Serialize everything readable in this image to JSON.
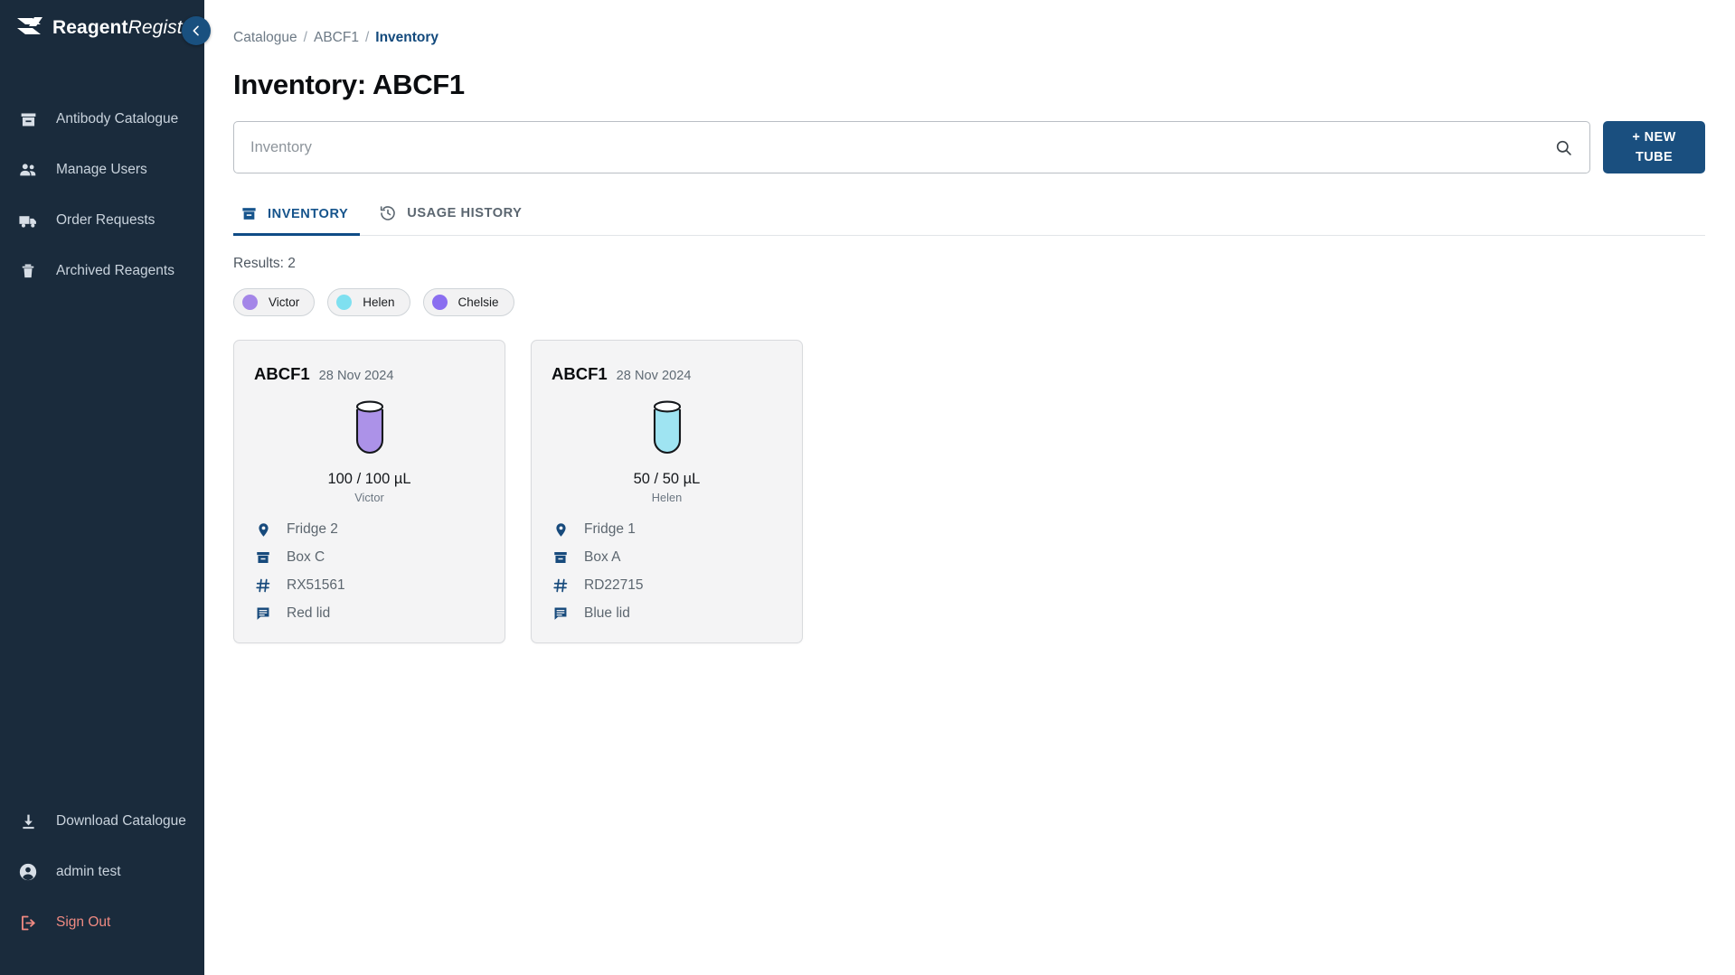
{
  "sidebar": {
    "brand": {
      "bold": "Reagent",
      "italic": "Registry",
      "logo_icon": "logo-chevrons-icon"
    },
    "collapse_icon": "chevron-left-icon",
    "top_items": [
      {
        "label": "Antibody Catalogue",
        "icon": "archive-box-icon"
      },
      {
        "label": "Manage Users",
        "icon": "people-icon"
      },
      {
        "label": "Order Requests",
        "icon": "truck-icon"
      },
      {
        "label": "Archived Reagents",
        "icon": "trash-icon"
      }
    ],
    "bottom_items": [
      {
        "label": "Download Catalogue",
        "icon": "download-icon"
      },
      {
        "label": "admin test",
        "icon": "account-circle-icon"
      },
      {
        "label": "Sign Out",
        "icon": "logout-icon"
      }
    ],
    "background_color": "#1a2b3c",
    "signout_color": "#f08a82"
  },
  "breadcrumb": {
    "items": [
      {
        "label": "Catalogue",
        "current": false
      },
      {
        "label": "ABCF1",
        "current": false
      },
      {
        "label": "Inventory",
        "current": true
      }
    ],
    "separator": "/"
  },
  "header": {
    "title": "Inventory: ABCF1"
  },
  "search": {
    "value": "",
    "placeholder": "Inventory",
    "icon": "search-icon"
  },
  "new_tube_button": {
    "line1": "+ NEW",
    "line2": "TUBE",
    "color": "#1a4f7f"
  },
  "tabs": [
    {
      "label": "INVENTORY",
      "icon": "archive-box-icon",
      "active": true
    },
    {
      "label": "USAGE HISTORY",
      "icon": "history-icon",
      "active": false
    }
  ],
  "results": {
    "label": "Results: 2",
    "count": 2
  },
  "user_chips": [
    {
      "name": "Victor",
      "color": "#a486e8"
    },
    {
      "name": "Helen",
      "color": "#7fe0f0"
    },
    {
      "name": "Chelsie",
      "color": "#8a6ef0"
    }
  ],
  "cards": [
    {
      "code": "ABCF1",
      "date": "28 Nov 2024",
      "volume": "100 / 100 µL",
      "owner": "Victor",
      "tube_color": "#ac92e8",
      "fill_fraction": 1.0,
      "meta": [
        {
          "icon": "location-pin-icon",
          "text": "Fridge 2"
        },
        {
          "icon": "archive-box-icon",
          "text": "Box C"
        },
        {
          "icon": "hash-icon",
          "text": "RX51561"
        },
        {
          "icon": "comment-icon",
          "text": "Red lid"
        }
      ]
    },
    {
      "code": "ABCF1",
      "date": "28 Nov 2024",
      "volume": "50 / 50 µL",
      "owner": "Helen",
      "tube_color": "#9fe4f2",
      "fill_fraction": 1.0,
      "meta": [
        {
          "icon": "location-pin-icon",
          "text": "Fridge 1"
        },
        {
          "icon": "archive-box-icon",
          "text": "Box A"
        },
        {
          "icon": "hash-icon",
          "text": "RD22715"
        },
        {
          "icon": "comment-icon",
          "text": "Blue lid"
        }
      ]
    }
  ]
}
